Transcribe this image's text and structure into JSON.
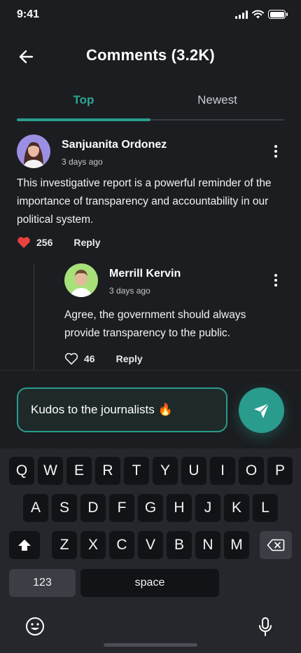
{
  "status_bar": {
    "time": "9:41"
  },
  "header": {
    "title": "Comments (3.2K)"
  },
  "tabs": [
    {
      "label": "Top",
      "active": true
    },
    {
      "label": "Newest",
      "active": false
    }
  ],
  "comments": [
    {
      "author": "Sanjuanita Ordonez",
      "time": "3 days ago",
      "text": "This investigative report is a powerful reminder of the importance of transparency and accountability in our political system.",
      "likes": "256",
      "liked": true,
      "reply_label": "Reply"
    },
    {
      "author": "Merrill Kervin",
      "time": "3 days ago",
      "text": "Agree, the government should always provide transparency to the public.",
      "likes": "46",
      "liked": false,
      "reply_label": "Reply"
    }
  ],
  "comment_input": {
    "value": "Kudos to the journalists 🔥"
  },
  "keyboard": {
    "row1": [
      "Q",
      "W",
      "E",
      "R",
      "T",
      "Y",
      "U",
      "I",
      "O",
      "P"
    ],
    "row2": [
      "A",
      "S",
      "D",
      "F",
      "G",
      "H",
      "J",
      "K",
      "L"
    ],
    "row3": [
      "Z",
      "X",
      "C",
      "V",
      "B",
      "N",
      "M"
    ],
    "numbers_label": "123",
    "space_label": "space"
  },
  "icons": {
    "back": "arrow-left-icon",
    "more": "more-vertical-icon",
    "like": "heart-icon",
    "send": "send-icon",
    "shift": "shift-icon",
    "delete": "backspace-icon",
    "emoji": "emoji-icon",
    "mic": "microphone-icon"
  },
  "colors": {
    "accent": "#2a9c8d",
    "like_active": "#e8413e",
    "background": "#1b1d20",
    "keyboard_bg": "#25272c"
  }
}
